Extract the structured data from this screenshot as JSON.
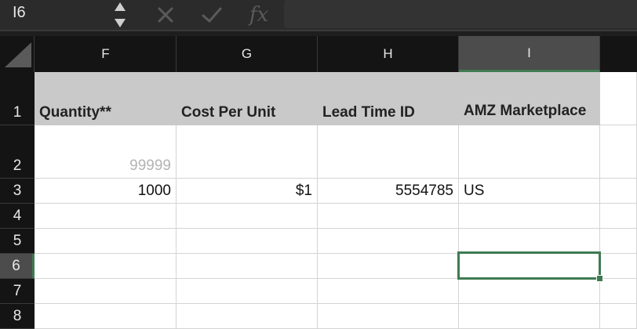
{
  "formula_bar": {
    "name_box": "I6",
    "cancel_icon": "cancel-x-icon",
    "enter_icon": "checkmark-icon",
    "function_label": "fx",
    "formula": ""
  },
  "columns": [
    "F",
    "G",
    "H",
    "I"
  ],
  "selected_column": "I",
  "rows": [
    "1",
    "2",
    "3",
    "4",
    "5",
    "6",
    "7",
    "8"
  ],
  "selected_row": "6",
  "headers": {
    "F": "Quantity**",
    "G": "Cost Per Unit",
    "H": "Lead Time ID",
    "I": "AMZ Marketplace"
  },
  "row2": {
    "F": "99999"
  },
  "row3": {
    "F": "1000",
    "G": "$1",
    "H": "5554785",
    "I": "US"
  },
  "colors": {
    "accent_green": "#3f7a52",
    "header_fill": "#c9c9c9",
    "placeholder_text": "#b3b3b3"
  }
}
